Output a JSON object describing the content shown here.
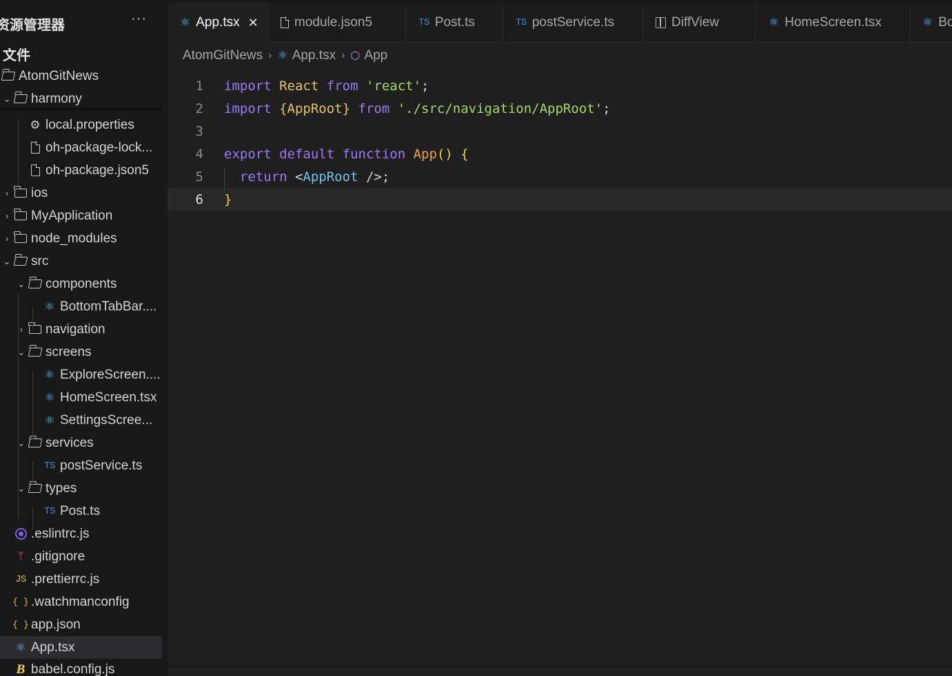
{
  "sidebar": {
    "title": "资源管理器",
    "more": "···",
    "section": "文件",
    "items": [
      {
        "label": "AtomGitNews",
        "chev": "",
        "icon": "folder-open-icon"
      },
      {
        "label": "harmony",
        "chev": "⌄",
        "icon": "folder-open-icon"
      },
      {
        "label": "local.properties",
        "chev": "",
        "icon": "gear-icon"
      },
      {
        "label": "oh-package-lock...",
        "chev": "",
        "icon": "file-icon"
      },
      {
        "label": "oh-package.json5",
        "chev": "",
        "icon": "file-icon"
      },
      {
        "label": "ios",
        "chev": "›",
        "icon": "folder-icon"
      },
      {
        "label": "MyApplication",
        "chev": "›",
        "icon": "folder-icon"
      },
      {
        "label": "node_modules",
        "chev": "›",
        "icon": "folder-icon"
      },
      {
        "label": "src",
        "chev": "⌄",
        "icon": "folder-open-icon"
      },
      {
        "label": "components",
        "chev": "⌄",
        "icon": "folder-open-icon"
      },
      {
        "label": "BottomTabBar....",
        "chev": "",
        "icon": "react-icon"
      },
      {
        "label": "navigation",
        "chev": "›",
        "icon": "folder-icon"
      },
      {
        "label": "screens",
        "chev": "⌄",
        "icon": "folder-open-icon"
      },
      {
        "label": "ExploreScreen....",
        "chev": "",
        "icon": "react-icon"
      },
      {
        "label": "HomeScreen.tsx",
        "chev": "",
        "icon": "react-icon"
      },
      {
        "label": "SettingsScree...",
        "chev": "",
        "icon": "react-icon"
      },
      {
        "label": "services",
        "chev": "⌄",
        "icon": "folder-open-icon"
      },
      {
        "label": "postService.ts",
        "chev": "",
        "icon": "typescript-icon"
      },
      {
        "label": "types",
        "chev": "⌄",
        "icon": "folder-open-icon"
      },
      {
        "label": "Post.ts",
        "chev": "",
        "icon": "typescript-icon"
      },
      {
        "label": ".eslintrc.js",
        "chev": "",
        "icon": "eslint-icon"
      },
      {
        "label": ".gitignore",
        "chev": "",
        "icon": "git-icon"
      },
      {
        "label": ".prettierrc.js",
        "chev": "",
        "icon": "javascript-icon"
      },
      {
        "label": ".watchmanconfig",
        "chev": "",
        "icon": "json-icon"
      },
      {
        "label": "app.json",
        "chev": "",
        "icon": "json-icon"
      },
      {
        "label": "App.tsx",
        "chev": "",
        "icon": "react-icon"
      },
      {
        "label": "babel.config.js",
        "chev": "",
        "icon": "babel-icon"
      }
    ],
    "icon_glyphs": {
      "ts": "TS",
      "js": "JS",
      "json": "{ }",
      "react": "⚛",
      "gear": "⚙",
      "git": "ᛘ",
      "babel": "B"
    }
  },
  "tabs": [
    {
      "label": "App.tsx",
      "icon": "react-icon",
      "active": true,
      "close": "✕"
    },
    {
      "label": "module.json5",
      "icon": "file-icon"
    },
    {
      "label": "Post.ts",
      "icon": "typescript-icon"
    },
    {
      "label": "postService.ts",
      "icon": "typescript-icon"
    },
    {
      "label": "DiffView",
      "icon": "diff-icon"
    },
    {
      "label": "HomeScreen.tsx",
      "icon": "react-icon"
    },
    {
      "label": "Bo",
      "icon": "react-icon"
    }
  ],
  "breadcrumb": {
    "parts": [
      "AtomGitNews",
      "App.tsx",
      "App"
    ],
    "separator": "›"
  },
  "editor": {
    "current_line": 6,
    "lines": [
      {
        "n": "1",
        "tokens": [
          [
            "k",
            "import"
          ],
          [
            "pl",
            " "
          ],
          [
            "ident",
            "React"
          ],
          [
            "pl",
            " "
          ],
          [
            "k",
            "from"
          ],
          [
            "pl",
            " "
          ],
          [
            "str",
            "'react'"
          ],
          [
            "pl",
            ";"
          ]
        ]
      },
      {
        "n": "2",
        "tokens": [
          [
            "k",
            "import"
          ],
          [
            "pl",
            " "
          ],
          [
            "ident",
            "{AppRoot}"
          ],
          [
            "pl",
            " "
          ],
          [
            "k",
            "from"
          ],
          [
            "pl",
            " "
          ],
          [
            "str",
            "'./src/navigation/AppRoot'"
          ],
          [
            "pl",
            ";"
          ]
        ]
      },
      {
        "n": "3",
        "tokens": []
      },
      {
        "n": "4",
        "tokens": [
          [
            "k",
            "export"
          ],
          [
            "pl",
            " "
          ],
          [
            "k",
            "default"
          ],
          [
            "pl",
            " "
          ],
          [
            "k",
            "function"
          ],
          [
            "pl",
            " "
          ],
          [
            "fn",
            "App"
          ],
          [
            "br",
            "() {"
          ]
        ]
      },
      {
        "n": "5",
        "tokens": [
          [
            "pl",
            "  "
          ],
          [
            "k",
            "return"
          ],
          [
            "pl",
            " <"
          ],
          [
            "tag",
            "AppRoot"
          ],
          [
            "pl",
            " />;"
          ]
        ]
      },
      {
        "n": "6",
        "tokens": [
          [
            "br",
            "}"
          ]
        ]
      }
    ]
  },
  "colors": {
    "background": "#181818",
    "editor_bg": "#1f1f1f",
    "keyword": "#9b7bf7",
    "string": "#a6d86a",
    "identifier": "#e6c46a",
    "react_icon": "#59b9f2",
    "ts_icon": "#3d8ed8"
  }
}
